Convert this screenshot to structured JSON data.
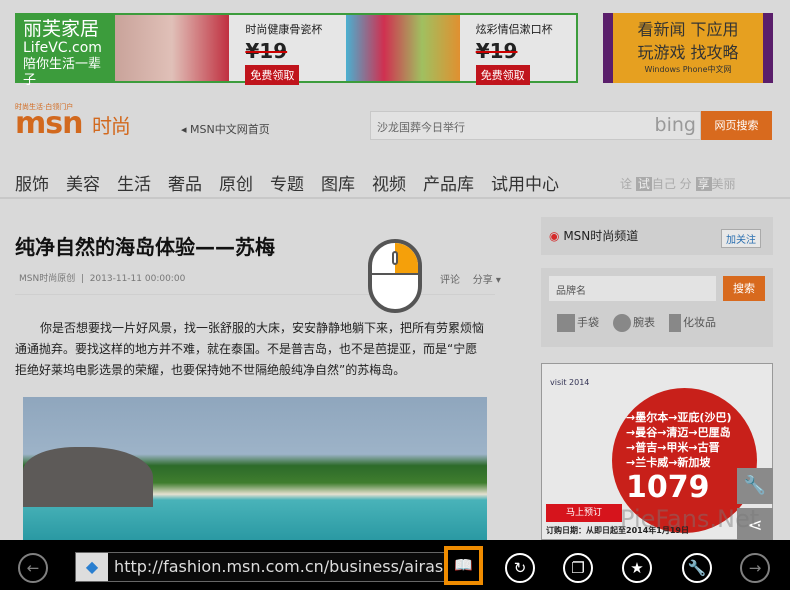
{
  "ads": {
    "lifevc": {
      "brand": "丽芙家居",
      "site": "LifeVC.com",
      "slogan": "陪你生活一辈子",
      "products": [
        {
          "name": "时尚健康骨瓷杯",
          "price": "¥19",
          "cta": "免费领取"
        },
        {
          "name": "炫彩情侣漱口杯",
          "price": "¥19",
          "cta": "免费领取"
        }
      ]
    },
    "wp": {
      "line1": "看新闻 下应用",
      "line2": "玩游戏 找攻略",
      "brand": "Windows Phone中文网"
    },
    "airasia": {
      "destinations": [
        "→墨尔本→亚庇(沙巴)",
        "→曼谷→清迈→巴厘岛",
        "→普吉→甲米→古晋",
        "→兰卡威→新加坡"
      ],
      "price": "1079",
      "cta": "马上预订",
      "dates": "订购日期：从即日起至2014年1月19日",
      "visit": "visit 2014"
    }
  },
  "header": {
    "logo_tag": "时尚生活·白领门户",
    "logo": "msn",
    "logo_suffix": "时尚",
    "home_link": "MSN中文网首页",
    "search_value": "沙龙国葬今日举行",
    "search_engine": "bing",
    "search_button": "网页搜索"
  },
  "nav": [
    "服饰",
    "美容",
    "生活",
    "奢品",
    "原创",
    "专题",
    "图库",
    "视频",
    "产品库",
    "试用中心"
  ],
  "slogan": {
    "a": "诠",
    "b": "试",
    "c": "自己 分",
    "d": "享",
    "e": "美丽"
  },
  "article": {
    "title": "纯净自然的海岛体验——苏梅",
    "source": "MSN时尚原创",
    "date": "2013-11-11 00:00:00",
    "comment": "评论",
    "share": "分享",
    "body": "你是否想要找一片好风景，找一张舒服的大床，安安静静地躺下来，把所有劳累烦恼通通抛弃。要找这样的地方并不难，就在泰国。不是普吉岛，也不是芭提亚，而是“宁愿拒绝好莱坞电影选景的荣耀，也要保持她不世隔绝般纯净自然”的苏梅岛。"
  },
  "sidebar": {
    "weibo": "MSN时尚频道",
    "follow": "加关注",
    "brand_placeholder": "品牌名",
    "brand_search": "搜索",
    "categories": [
      "手袋",
      "腕表",
      "化妆品"
    ]
  },
  "watermark": "PieFans.Net",
  "browser": {
    "url": "http://fashion.msn.com.cn/business/airasi",
    "reader_highlight": "#f08c00"
  }
}
